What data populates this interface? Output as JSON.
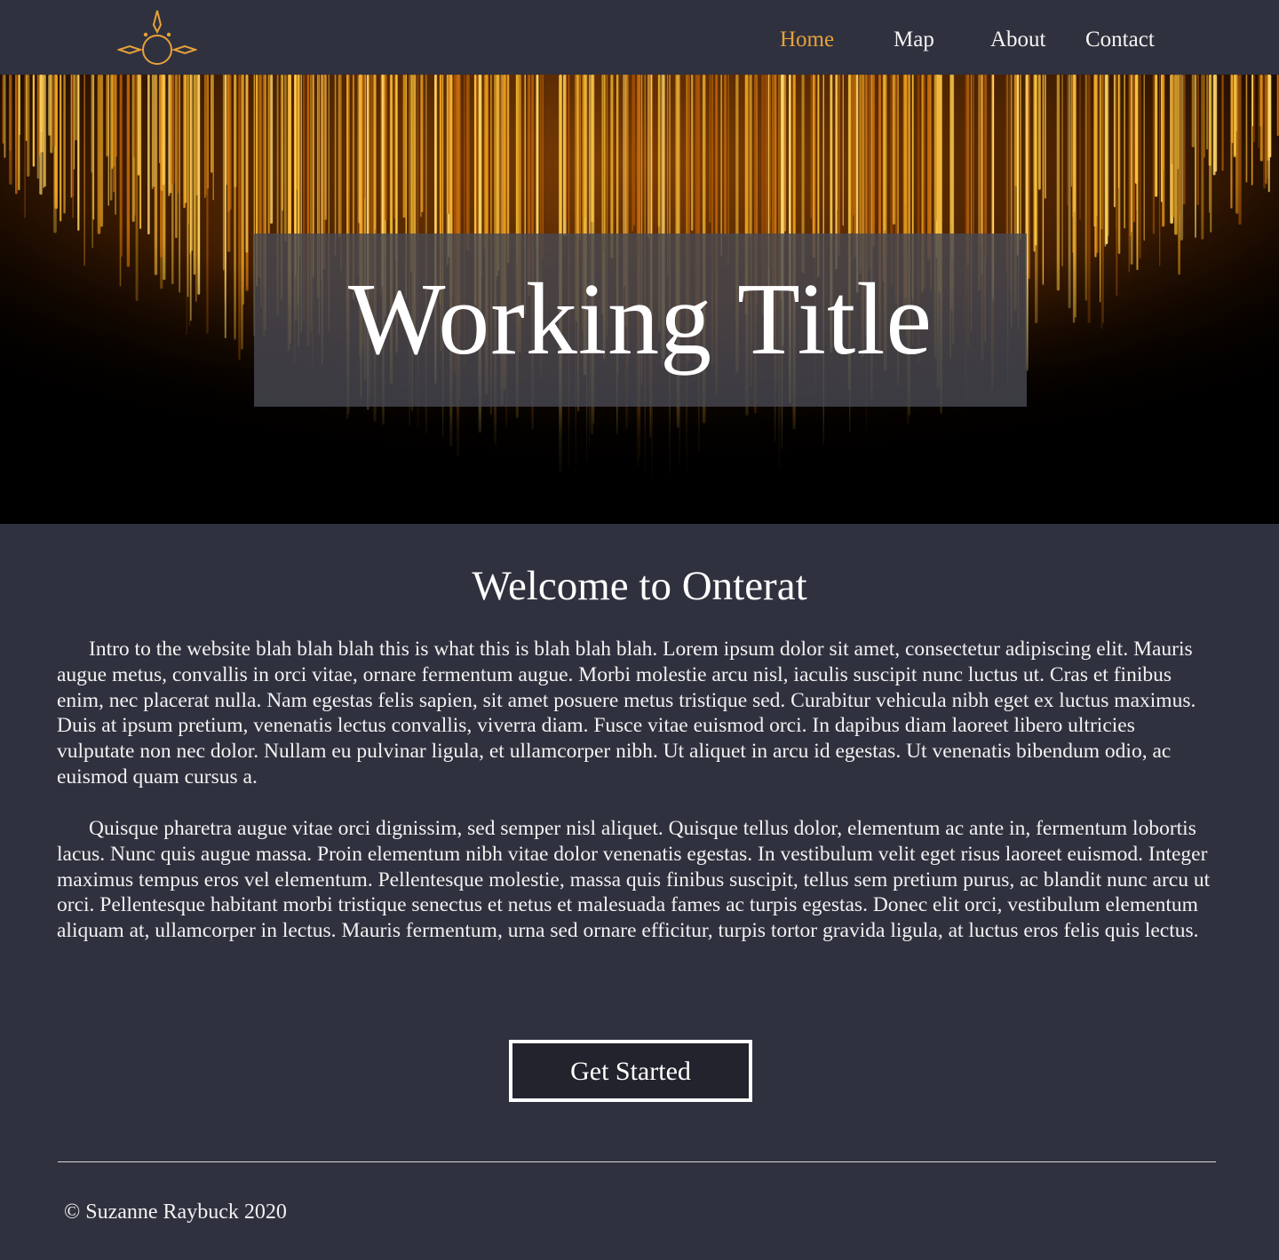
{
  "nav": {
    "items": [
      {
        "label": "Home",
        "active": true
      },
      {
        "label": "Map",
        "active": false
      },
      {
        "label": "About",
        "active": false
      },
      {
        "label": "Contact",
        "active": false
      }
    ]
  },
  "logo": {
    "icon": "sun-compass-logo-icon",
    "color": "#e8a13a"
  },
  "hero": {
    "title": "Working Title",
    "background": "golden-light-streaks-image"
  },
  "main": {
    "heading": "Welcome to Onterat",
    "paragraphs": [
      "Intro to the website blah blah blah this is what this is blah blah blah. Lorem ipsum dolor sit amet, consectetur adipiscing elit. Mauris augue metus, convallis in orci vitae, ornare fermentum augue. Morbi molestie arcu nisl, iaculis suscipit nunc luctus ut. Cras et finibus enim, nec placerat nulla. Nam egestas felis sapien, sit amet posuere metus tristique sed. Curabitur vehicula nibh eget ex luctus maximus. Duis at ipsum pretium, venenatis lectus convallis, viverra diam. Fusce vitae euismod orci. In dapibus diam laoreet libero ultricies vulputate non nec dolor. Nullam eu pulvinar ligula, et ullamcorper nibh. Ut aliquet in arcu id egestas. Ut venenatis bibendum odio, ac euismod quam cursus a.",
      "Quisque pharetra augue vitae orci dignissim, sed semper nisl aliquet. Quisque tellus dolor, elementum ac ante in, fermentum lobortis lacus. Nunc quis augue massa. Proin elementum nibh vitae dolor venenatis egestas. In vestibulum velit eget risus laoreet euismod. Integer maximus tempus eros vel elementum. Pellentesque molestie, massa quis finibus suscipit, tellus sem pretium purus, ac blandit nunc arcu ut orci. Pellentesque habitant morbi tristique senectus et netus et malesuada fames ac turpis egestas. Donec elit orci, vestibulum elementum aliquam at, ullamcorper in lectus. Mauris fermentum, urna sed ornare efficitur, turpis tortor gravida ligula, at luctus eros felis quis lectus."
    ],
    "cta_label": "Get Started"
  },
  "footer": {
    "copyright": "© Suzanne Raybuck 2020"
  },
  "colors": {
    "background": "#2f313e",
    "accent": "#e8a13a",
    "button_bg": "#22232c",
    "text": "#ffffff"
  }
}
